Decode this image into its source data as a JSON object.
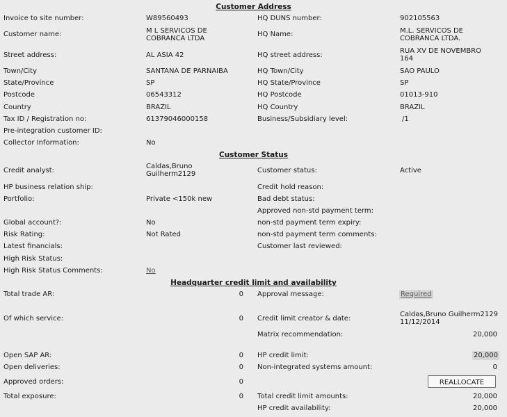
{
  "customer_address": {
    "title": "Customer Address",
    "invoice_site_number": {
      "label": "Invoice to site number:",
      "value": "W89560493"
    },
    "customer_name": {
      "label": "Customer name:",
      "value": "M L SERVICOS DE COBRANCA LTDA"
    },
    "street_address": {
      "label": "Street address:",
      "value": "AL ASIA 42"
    },
    "town_city": {
      "label": "Town/City",
      "value": "SANTANA DE PARNAIBA"
    },
    "state_province": {
      "label": "State/Province",
      "value": "SP"
    },
    "postcode": {
      "label": "Postcode",
      "value": "06543312"
    },
    "country": {
      "label": "Country",
      "value": "BRAZIL"
    },
    "tax_id": {
      "label": "Tax ID / Registration no:",
      "value": "61379046000158"
    },
    "pre_integration_id": {
      "label": "Pre-integration customer ID:",
      "value": ""
    },
    "collector_info": {
      "label": "Collector Information:",
      "value": "No"
    },
    "hq_duns": {
      "label": "HQ DUNS number:",
      "value": "902105563"
    },
    "hq_name": {
      "label": "HQ Name:",
      "value": "M.L. SERVICOS DE COBRANCA LTDA."
    },
    "hq_street": {
      "label": "HQ street address:",
      "value": "RUA XV DE NOVEMBRO 164"
    },
    "hq_town": {
      "label": "HQ Town/City",
      "value": "SAO PAULO"
    },
    "hq_state": {
      "label": "HQ State/Province",
      "value": "SP"
    },
    "hq_postcode": {
      "label": "HQ Postcode",
      "value": "01013-910"
    },
    "hq_country": {
      "label": "HQ Country",
      "value": "BRAZIL"
    },
    "business_level": {
      "label": "Business/Subsidiary level:",
      "value": "/1"
    }
  },
  "customer_status": {
    "title": "Customer Status",
    "credit_analyst": {
      "label": "Credit analyst:",
      "value": "Caldas,Bruno Guilherm2129"
    },
    "hp_business_relationship": {
      "label": "HP business relation ship:",
      "value": ""
    },
    "portfolio": {
      "label": "Portfolio:",
      "value": "Private <150k new"
    },
    "global_account": {
      "label": "Global account?:",
      "value": "No"
    },
    "risk_rating": {
      "label": "Risk Rating:",
      "value": "Not Rated"
    },
    "latest_financials": {
      "label": "Latest financials:",
      "value": ""
    },
    "high_risk_status": {
      "label": "High Risk Status:",
      "value": ""
    },
    "high_risk_comments": {
      "label": "High Risk Status Comments:",
      "value": "No"
    },
    "status": {
      "label": "Customer status:",
      "value": "Active"
    },
    "credit_hold_reason": {
      "label": "Credit hold reason:",
      "value": ""
    },
    "bad_debt_status": {
      "label": "Bad debt status:",
      "value": ""
    },
    "approved_nonstd_term": {
      "label": "Approved non-std payment term:",
      "value": ""
    },
    "nonstd_term_expiry": {
      "label": "non-std payment term expiry:",
      "value": ""
    },
    "nonstd_term_comments": {
      "label": "non-std payment term comments:",
      "value": ""
    },
    "last_reviewed": {
      "label": "Customer last reviewed:",
      "value": ""
    }
  },
  "hq_credit": {
    "title": "Headquarter credit limit and availability",
    "total_trade_ar": {
      "label": "Total trade AR:",
      "value": "0"
    },
    "of_which_service": {
      "label": "Of which service:",
      "value": "0"
    },
    "open_sap_ar": {
      "label": "Open SAP AR:",
      "value": "0"
    },
    "open_deliveries": {
      "label": "Open deliveries:",
      "value": "0"
    },
    "approved_orders": {
      "label": "Approved orders:",
      "value": "0"
    },
    "total_exposure": {
      "label": "Total exposure:",
      "value": "0"
    },
    "approval_message": {
      "label": "Approval message:",
      "value": "Required"
    },
    "limit_creator": {
      "label": "Credit limit creator & date:",
      "value": "Caldas,Bruno Guilherm2129 11/12/2014"
    },
    "matrix_recommendation": {
      "label": "Matrix recommendation:",
      "value": "20,000"
    },
    "hp_credit_limit": {
      "label": "HP credit limit:",
      "value": "20,000"
    },
    "non_integrated_amount": {
      "label": "Non-integrated systems amount:",
      "value": "0"
    },
    "reallocate_label": "REALLOCATE",
    "total_limit_amounts": {
      "label": "Total credit limit amounts:",
      "value": "20,000"
    },
    "hp_credit_availability": {
      "label": "HP credit availability:",
      "value": "20,000"
    }
  }
}
